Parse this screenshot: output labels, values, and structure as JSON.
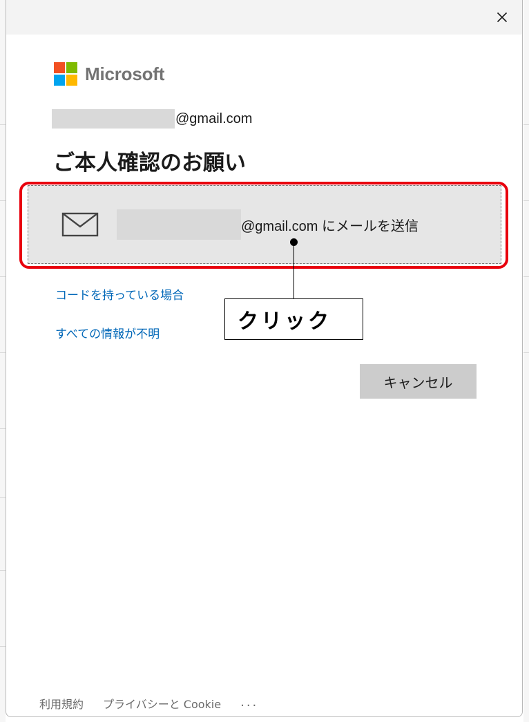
{
  "window": {
    "close_icon": "close-icon"
  },
  "brand": {
    "name": "Microsoft",
    "colors": [
      "#f25022",
      "#7fba00",
      "#00a4ef",
      "#ffb900"
    ]
  },
  "account": {
    "email_suffix": "@gmail.com"
  },
  "page": {
    "heading": "ご本人確認のお願い"
  },
  "verify_option": {
    "icon": "mail-icon",
    "label": "@gmail.com にメールを送信"
  },
  "links": {
    "have_code": "コードを持っている場合",
    "no_info": "すべての情報が不明"
  },
  "annotation": {
    "label": "クリック",
    "highlight_color": "#e8000d"
  },
  "buttons": {
    "cancel": "キャンセル"
  },
  "footer": {
    "terms": "利用規約",
    "privacy": "プライバシーと Cookie",
    "more": "..."
  },
  "colors": {
    "link": "#0067b8",
    "option_bg": "#e6e6e6",
    "button_bg": "#cccccc"
  }
}
